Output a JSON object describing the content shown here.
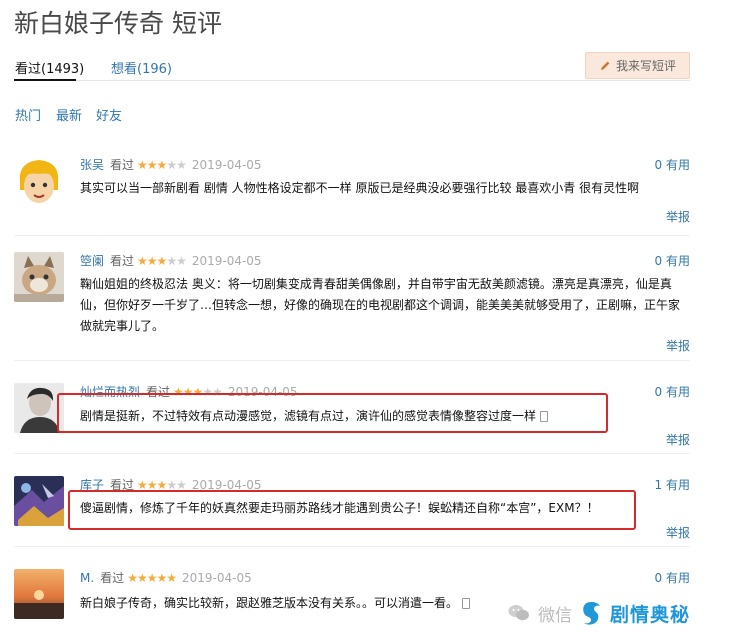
{
  "page": {
    "title": "新白娘子传奇 短评",
    "tabs": [
      {
        "label": "看过(1493)"
      },
      {
        "label": "想看(196)"
      }
    ],
    "write_button": "我来写短评",
    "filters": [
      "热门",
      "最新",
      "好友"
    ],
    "report_label": "举报"
  },
  "reviews": [
    {
      "user": "张吴",
      "status": "看过",
      "rating": 3,
      "date": "2019-04-05",
      "useful": "0 有用",
      "content": "其实可以当一部新剧看 剧情 人物性格设定都不一样 原版已是经典没必要强行比较 最喜欢小青 很有灵性啊"
    },
    {
      "user": "箜阑",
      "status": "看过",
      "rating": 3,
      "date": "2019-04-05",
      "useful": "0 有用",
      "content": "鞠仙姐姐的终极忍法 奥义：将一切剧集变成青春甜美偶像剧，并自带宇宙无敌美颜滤镜。漂亮是真漂亮，仙是真仙，但你好歹一千岁了…但转念一想，好像的确现在的电视剧都这个调调，能美美美就够受用了，正剧嘛，正午家做就完事儿了。"
    },
    {
      "user": "灿烂而热烈",
      "status": "看过",
      "rating": 3,
      "date": "2019-04-05",
      "useful": "0 有用",
      "content": "剧情是挺新，不过特效有点动漫感觉，滤镜有点过，演许仙的感觉表情像整容过度一样"
    },
    {
      "user": "库子",
      "status": "看过",
      "rating": 3,
      "date": "2019-04-05",
      "useful": "1 有用",
      "content": "傻逼剧情，修炼了千年的妖真然要走玛丽苏路线才能遇到贵公子！蜈蚣精还自称“本宫”，EXM？！"
    },
    {
      "user": "M.",
      "status": "看过",
      "rating": 5,
      "date": "2019-04-05",
      "useful": "0 有用",
      "content": "新白娘子传奇，确实比较新，跟赵雅芝版本没有关系。。可以消遣一看。"
    }
  ],
  "watermark": {
    "wechat": "微信",
    "brand": "剧情奥秘"
  },
  "colors": {
    "link": "#3377aa",
    "star": "#f4ac3c",
    "highlight_box": "#d42a2a",
    "brand": "#1f97d9"
  }
}
